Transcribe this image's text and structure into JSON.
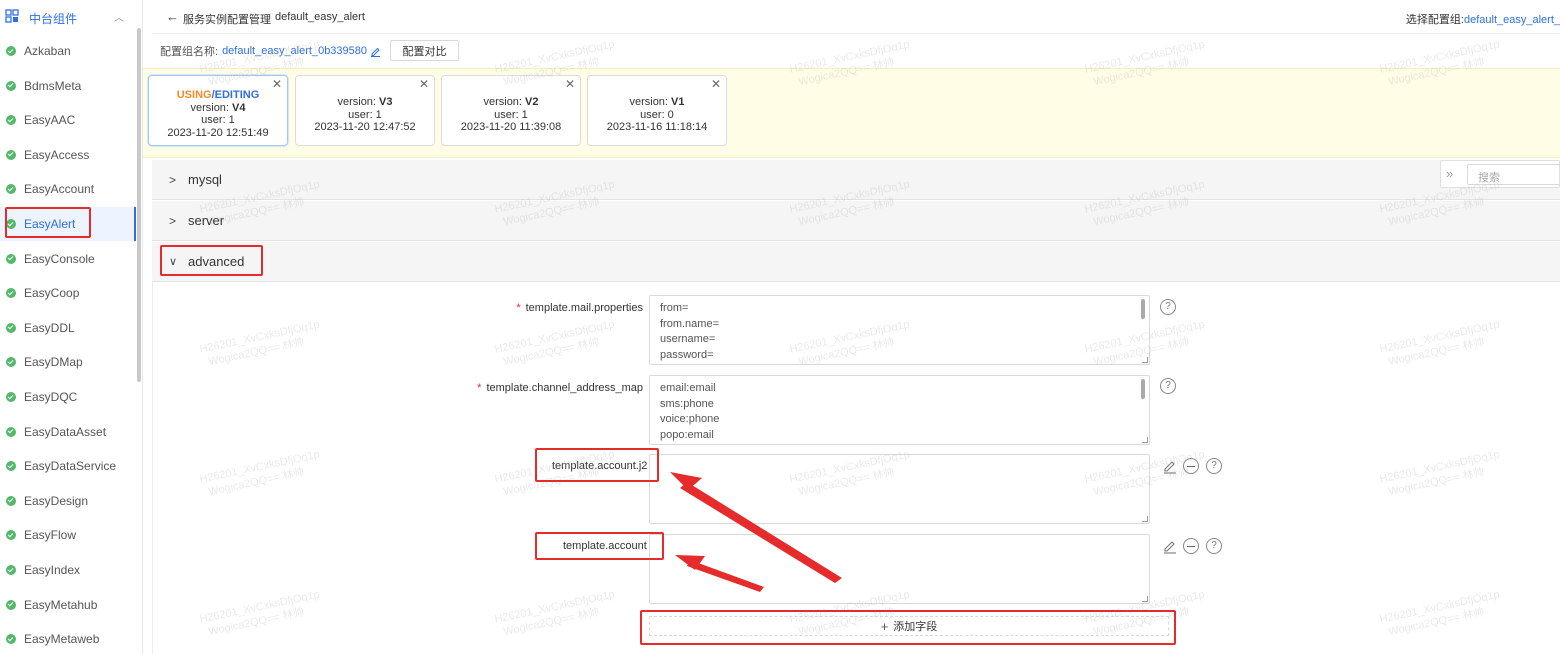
{
  "sidebar": {
    "title": "中台组件",
    "items": [
      {
        "label": "Azkaban"
      },
      {
        "label": "BdmsMeta"
      },
      {
        "label": "EasyAAC"
      },
      {
        "label": "EasyAccess"
      },
      {
        "label": "EasyAccount"
      },
      {
        "label": "EasyAlert"
      },
      {
        "label": "EasyConsole"
      },
      {
        "label": "EasyCoop"
      },
      {
        "label": "EasyDDL"
      },
      {
        "label": "EasyDMap"
      },
      {
        "label": "EasyDQC"
      },
      {
        "label": "EasyDataAsset"
      },
      {
        "label": "EasyDataService"
      },
      {
        "label": "EasyDesign"
      },
      {
        "label": "EasyFlow"
      },
      {
        "label": "EasyIndex"
      },
      {
        "label": "EasyMetahub"
      },
      {
        "label": "EasyMetaweb"
      }
    ],
    "active_item": "EasyAlert",
    "status_color": "#52b96a"
  },
  "header": {
    "breadcrumb": "服务实例配置管理",
    "instance": "default_easy_alert",
    "select_config_label": "选择配置组:",
    "select_config_value": "default_easy_alert_"
  },
  "config": {
    "name_label": "配置组名称:",
    "name_value": "default_easy_alert_0b339580",
    "compare_button": "配置对比"
  },
  "versions": [
    {
      "status_using": "USING",
      "status_sep": "/",
      "status_editing": "EDITING",
      "version_label": "version: ",
      "version": "V4",
      "user": "user: 1",
      "time": "2023-11-20 12:51:49"
    },
    {
      "version_label": "version: ",
      "version": "V3",
      "user": "user: 1",
      "time": "2023-11-20 12:47:52"
    },
    {
      "version_label": "version: ",
      "version": "V2",
      "user": "user: 1",
      "time": "2023-11-20 11:39:08"
    },
    {
      "version_label": "version: ",
      "version": "V1",
      "user": "user: 0",
      "time": "2023-11-16 11:18:14"
    }
  ],
  "sections": [
    {
      "title": "mysql",
      "expanded": false
    },
    {
      "title": "server",
      "expanded": false
    },
    {
      "title": "advanced",
      "expanded": true
    }
  ],
  "search": {
    "placeholder": "搜索"
  },
  "fields": [
    {
      "key": "template.mail.properties",
      "required": true,
      "lines": [
        "from=",
        "from.name=",
        "username=",
        "password="
      ]
    },
    {
      "key": "template.channel_address_map",
      "required": true,
      "lines": [
        "email:email",
        "sms:phone",
        "voice:phone",
        "popo:email"
      ]
    },
    {
      "key": "template.account.j2",
      "required": false,
      "lines": []
    },
    {
      "key": "template.account",
      "required": false,
      "lines": []
    }
  ],
  "add_field_button": "添加字段",
  "watermark": {
    "line1": "H26201_XvCxksDfjOq1p",
    "line2": "Wogica2QQ== 林帅"
  },
  "colors": {
    "accent": "#2f6fe0",
    "using": "#f08c2a",
    "annotation_red": "#e52b2b",
    "version_strip": "#fffde6"
  }
}
